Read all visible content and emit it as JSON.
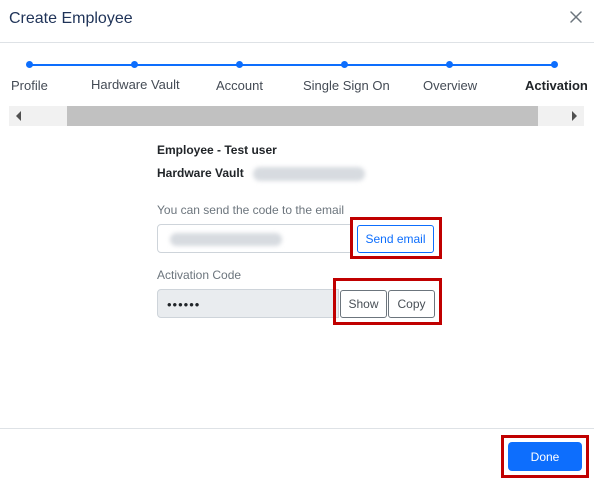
{
  "dialog": {
    "title": "Create Employee"
  },
  "stepper": {
    "steps": [
      {
        "label": "Profile"
      },
      {
        "label": "Hardware Vault"
      },
      {
        "label": "Account"
      },
      {
        "label": "Single Sign On"
      },
      {
        "label": "Overview"
      },
      {
        "label": "Activation"
      }
    ],
    "active_step": "Activation",
    "accent_color": "#0d6efd"
  },
  "summary": {
    "employee_text": "Employee - Test user",
    "hardware_vault_label": "Hardware Vault"
  },
  "email_section": {
    "label": "You can send the code to the email",
    "send_button": "Send email"
  },
  "activation_section": {
    "label": "Activation Code",
    "code_masked": "••••••",
    "show_button": "Show",
    "copy_button": "Copy"
  },
  "footer": {
    "done_button": "Done"
  },
  "annotation_color": "#c00000"
}
